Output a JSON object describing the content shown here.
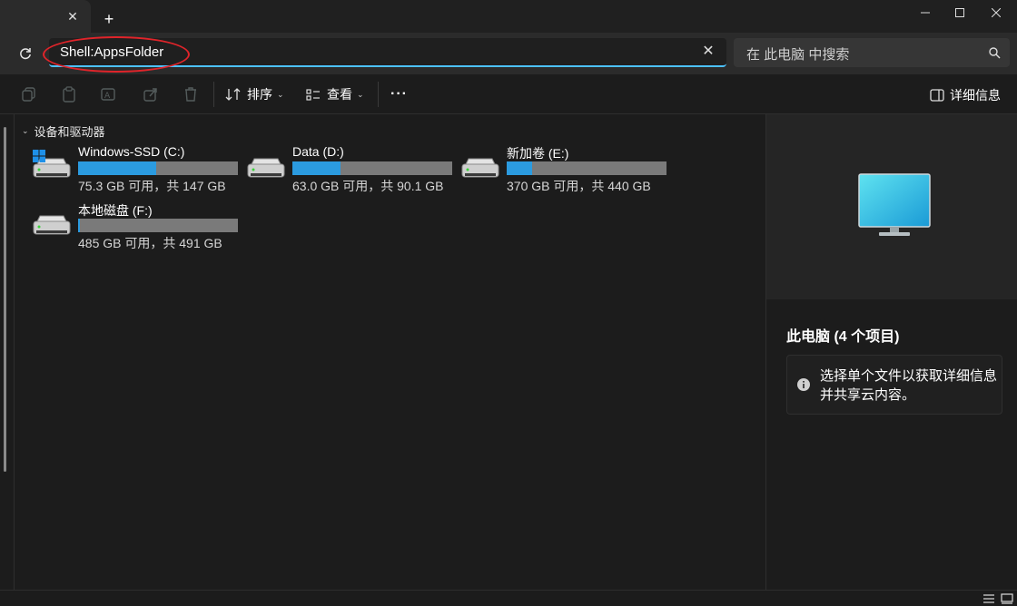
{
  "tab": {
    "close_glyph": "✕",
    "new_tab_glyph": "+"
  },
  "window": {
    "minimize": "—",
    "maximize": "☐",
    "close": "✕"
  },
  "address": {
    "value": "Shell:AppsFolder",
    "clear_glyph": "✕"
  },
  "search": {
    "placeholder": "在 此电脑 中搜索"
  },
  "toolbar": {
    "sort_label": "排序",
    "view_label": "查看",
    "more_label": "···",
    "details_label": "详细信息"
  },
  "group": {
    "label": "设备和驱动器"
  },
  "drives": [
    {
      "name": "Windows-SSD (C:)",
      "info": "75.3 GB 可用，共 147 GB",
      "used_fraction": 0.49,
      "system": true
    },
    {
      "name": "Data (D:)",
      "info": "63.0 GB 可用，共 90.1 GB",
      "used_fraction": 0.3,
      "system": false
    },
    {
      "name": "新加卷 (E:)",
      "info": "370 GB 可用，共 440 GB",
      "used_fraction": 0.16,
      "system": false
    },
    {
      "name": "本地磁盘 (F:)",
      "info": "485 GB 可用，共 491 GB",
      "used_fraction": 0.01,
      "system": false
    }
  ],
  "details": {
    "title": "此电脑 (4 个项目)",
    "info_text": "选择单个文件以获取详细信息并共享云内容。"
  },
  "colors": {
    "accent": "#4cc2ff",
    "drive_fill": "#2b9be0",
    "drive_track": "#7a7a7a",
    "highlight_ring": "#e0242a"
  }
}
